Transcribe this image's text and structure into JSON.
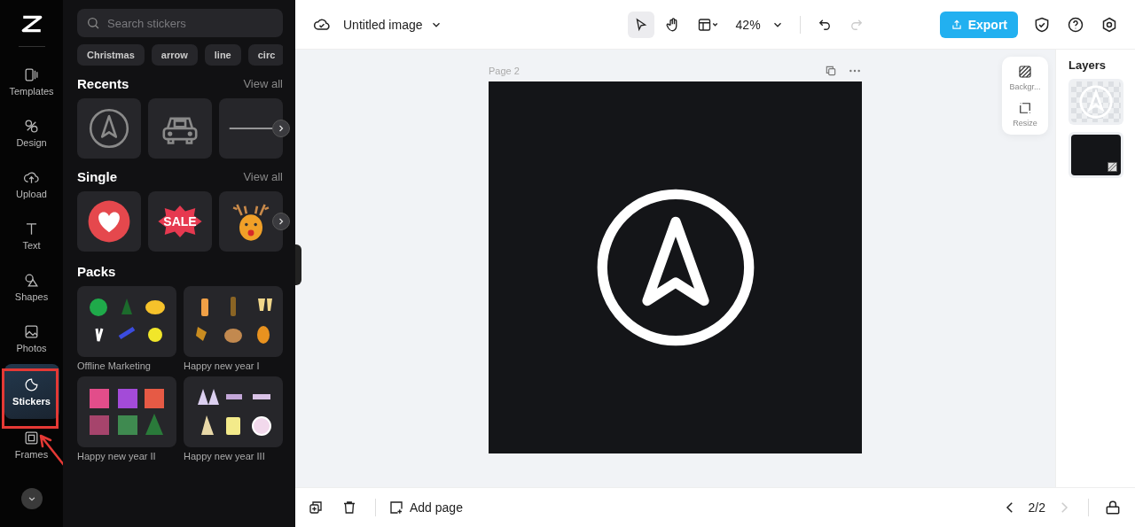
{
  "rail": {
    "items": [
      {
        "label": "Templates",
        "kind": "templates",
        "selected": false
      },
      {
        "label": "Design",
        "kind": "design",
        "selected": false
      },
      {
        "label": "Upload",
        "kind": "upload",
        "selected": false
      },
      {
        "label": "Text",
        "kind": "text",
        "selected": false
      },
      {
        "label": "Shapes",
        "kind": "shapes",
        "selected": false
      },
      {
        "label": "Photos",
        "kind": "photos",
        "selected": false
      },
      {
        "label": "Stickers",
        "kind": "stickers",
        "selected": true
      },
      {
        "label": "Frames",
        "kind": "frames",
        "selected": false
      }
    ]
  },
  "sticker_panel": {
    "search": {
      "placeholder": "Search stickers"
    },
    "tags": [
      "Christmas",
      "arrow",
      "line",
      "circ"
    ],
    "sections": [
      {
        "title": "Recents",
        "view_all": "View all",
        "items": [
          {
            "kind": "compass"
          },
          {
            "kind": "car"
          },
          {
            "kind": "line"
          }
        ]
      },
      {
        "title": "Single",
        "view_all": "View all",
        "items": [
          {
            "kind": "heart"
          },
          {
            "kind": "sale",
            "text": "SALE"
          },
          {
            "kind": "reindeer"
          }
        ]
      }
    ],
    "packs_title": "Packs",
    "packs": [
      "Offline Marketing",
      "Happy new year I",
      "Happy new year II",
      "Happy new year III"
    ]
  },
  "topbar": {
    "title": "Untitled image",
    "zoom": "42%",
    "export": "Export"
  },
  "canvas": {
    "page_label": "Page 2"
  },
  "float_tools": [
    {
      "kind": "background",
      "label": "Backgr..."
    },
    {
      "kind": "resize",
      "label": "Resize"
    }
  ],
  "layers": {
    "title": "Layers",
    "items": [
      {
        "kind": "logo"
      },
      {
        "kind": "fill"
      }
    ]
  },
  "bottombar": {
    "add_page": "Add page",
    "pager": "2/2"
  }
}
